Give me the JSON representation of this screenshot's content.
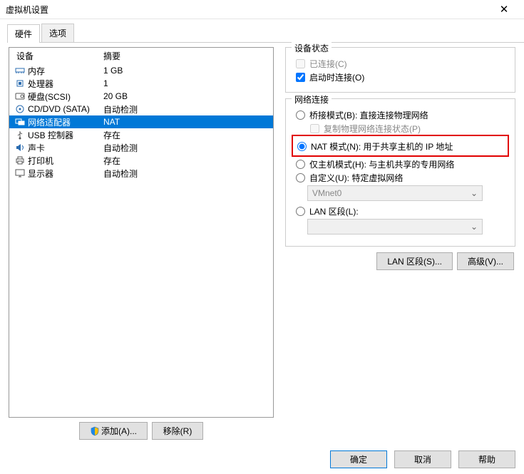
{
  "title": "虚拟机设置",
  "tabs": {
    "hardware": "硬件",
    "options": "选项"
  },
  "headers": {
    "device": "设备",
    "summary": "摘要"
  },
  "devices": [
    {
      "icon": "memory",
      "name": "内存",
      "summary": "1 GB"
    },
    {
      "icon": "cpu",
      "name": "处理器",
      "summary": "1"
    },
    {
      "icon": "disk",
      "name": "硬盘(SCSI)",
      "summary": "20 GB"
    },
    {
      "icon": "cd",
      "name": "CD/DVD (SATA)",
      "summary": "自动检测"
    },
    {
      "icon": "net",
      "name": "网络适配器",
      "summary": "NAT"
    },
    {
      "icon": "usb",
      "name": "USB 控制器",
      "summary": "存在"
    },
    {
      "icon": "sound",
      "name": "声卡",
      "summary": "自动检测"
    },
    {
      "icon": "printer",
      "name": "打印机",
      "summary": "存在"
    },
    {
      "icon": "display",
      "name": "显示器",
      "summary": "自动检测"
    }
  ],
  "selected_index": 4,
  "left_buttons": {
    "add": "添加(A)...",
    "remove": "移除(R)"
  },
  "status_group": {
    "title": "设备状态",
    "connected": "已连接(C)",
    "connect_on_power": "启动时连接(O)",
    "connected_checked": false,
    "connected_enabled": false,
    "power_checked": true
  },
  "net_group": {
    "title": "网络连接",
    "bridge": "桥接模式(B): 直接连接物理网络",
    "replicate": "复制物理网络连接状态(P)",
    "nat": "NAT 模式(N): 用于共享主机的 IP 地址",
    "host_only": "仅主机模式(H): 与主机共享的专用网络",
    "custom": "自定义(U): 特定虚拟网络",
    "vmnet_value": "VMnet0",
    "lan": "LAN 区段(L):",
    "selected": "nat"
  },
  "right_buttons": {
    "lan": "LAN 区段(S)...",
    "advanced": "高级(V)..."
  },
  "footer": {
    "ok": "确定",
    "cancel": "取消",
    "help": "帮助"
  }
}
